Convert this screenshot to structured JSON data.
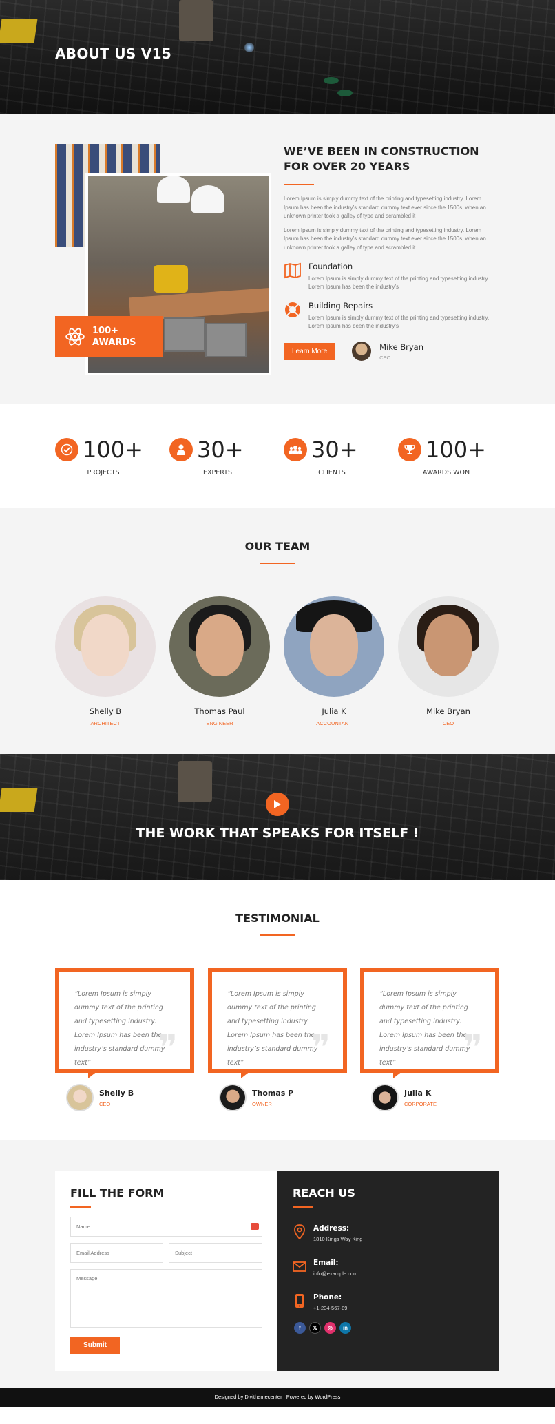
{
  "hero": {
    "title": "ABOUT US V15"
  },
  "about": {
    "heading_line1": "WE’VE BEEN IN CONSTRUCTION",
    "heading_line2": "FOR OVER 20 YEARS",
    "paragraphs": [
      "Lorem Ipsum is simply dummy text of the printing and typesetting industry. Lorem Ipsum has been the industry’s standard dummy text ever since the 1500s, when an unknown printer took a galley of type and scrambled it",
      "Lorem Ipsum is simply dummy text of the printing and typesetting industry. Lorem Ipsum has been the industry’s standard dummy text ever since the 1500s, when an unknown printer took a galley of type and scrambled it"
    ],
    "features": [
      {
        "title": "Foundation",
        "text": "Lorem Ipsum is simply dummy text of the printing and typesetting industry. Lorem Ipsum has been the industry’s",
        "icon": "book-icon"
      },
      {
        "title": "Building Repairs",
        "text": "Lorem Ipsum is simply dummy text of the printing and typesetting industry. Lorem Ipsum has been the industry’s",
        "icon": "lifebuoy-icon"
      }
    ],
    "button_label": "Learn More",
    "ceo_name": "Mike Bryan",
    "ceo_role": "CEO",
    "awards_line1": "100+",
    "awards_line2": "AWARDS"
  },
  "stats": [
    {
      "number": "100+",
      "label": "PROJECTS",
      "icon": "check-icon"
    },
    {
      "number": "30+",
      "label": "EXPERTS",
      "icon": "person-icon"
    },
    {
      "number": "30+",
      "label": "CLIENTS",
      "icon": "group-icon"
    },
    {
      "number": "100+",
      "label": "AWARDS WON",
      "icon": "trophy-icon"
    }
  ],
  "team": {
    "title": "OUR TEAM",
    "members": [
      {
        "name": "Shelly B",
        "role": "ARCHITECT"
      },
      {
        "name": "Thomas Paul",
        "role": "ENGINEER"
      },
      {
        "name": "Julia K",
        "role": "ACCOUNTANT"
      },
      {
        "name": "Mike Bryan",
        "role": "CEO"
      }
    ]
  },
  "video": {
    "text": "THE WORK THAT SPEAKS FOR ITSELF !"
  },
  "testimonial": {
    "title": "TESTIMONIAL",
    "items": [
      {
        "quote": "“Lorem Ipsum is simply dummy text of the printing and typesetting industry. Lorem Ipsum has been the industry’s standard dummy text”",
        "name": "Shelly B",
        "role": "CEO"
      },
      {
        "quote": "“Lorem Ipsum is simply dummy text of the printing and typesetting industry. Lorem Ipsum has been the industry’s standard dummy text”",
        "name": "Thomas P",
        "role": "OWNER"
      },
      {
        "quote": "“Lorem Ipsum is simply dummy text of the printing and typesetting industry. Lorem Ipsum has been the industry’s standard dummy text”",
        "name": "Julia K",
        "role": "CORPORATE"
      }
    ]
  },
  "form": {
    "title": "FILL THE FORM",
    "name_placeholder": "Name",
    "email_placeholder": "Email Address",
    "subject_placeholder": "Subject",
    "message_placeholder": "Message",
    "submit_label": "Submit"
  },
  "reach": {
    "title": "REACH US",
    "address_label": "Address:",
    "address_value": "1810 Kings Way King",
    "email_label": "Email:",
    "email_value": "info@example.com",
    "phone_label": "Phone:",
    "phone_value": "+1-234-567-89",
    "socials": [
      "f",
      "𝕏",
      "◎",
      "in"
    ]
  },
  "footer": {
    "text": "Designed by Divithemecenter | Powered by WordPress"
  },
  "colors": {
    "accent": "#f26522",
    "dark": "#232323"
  }
}
